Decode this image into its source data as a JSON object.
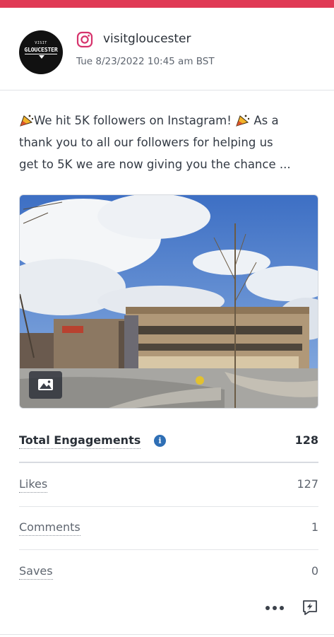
{
  "post": {
    "account_name": "visitgloucester",
    "timestamp": "Tue 8/23/2022 10:45 am BST",
    "network_icon": "instagram-icon",
    "avatar_text_small": "VISIT",
    "avatar_text_main": "GLOUCESTER",
    "caption_lines": [
      "We hit 5K followers on Instagram!",
      " As a",
      "thank you to all our followers for helping us",
      "get to 5K we are now giving you the chance ..."
    ],
    "media_type_icon": "image-icon"
  },
  "metrics": {
    "total_engagements": {
      "label": "Total Engagements",
      "value": "128"
    },
    "likes": {
      "label": "Likes",
      "value": "127"
    },
    "comments": {
      "label": "Comments",
      "value": "1"
    },
    "saves": {
      "label": "Saves",
      "value": "0"
    }
  },
  "actions": {
    "more_icon": "more-options-icon",
    "reply_icon": "reply-lightning-icon"
  },
  "colors": {
    "accent_bar": "#e03a55",
    "instagram": "#d6336c",
    "info": "#2f6fb5"
  }
}
